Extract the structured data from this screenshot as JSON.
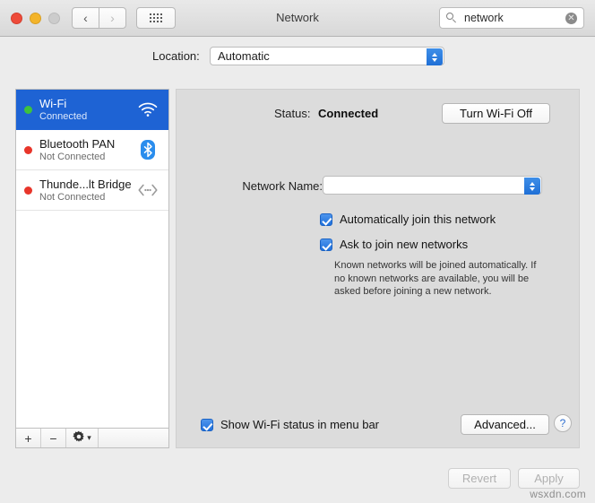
{
  "window": {
    "title": "Network",
    "traffic_lights": {
      "close": "close-button",
      "minimize": "minimize-button",
      "zoom": "zoom-button-disabled"
    },
    "nav": {
      "back": "‹",
      "forward": "›"
    },
    "show_all": "show-all-grid",
    "search": {
      "value": "network",
      "placeholder": "Search",
      "clear": "✕"
    }
  },
  "location": {
    "label": "Location:",
    "value": "Automatic"
  },
  "sidebar": {
    "services": [
      {
        "name": "Wi-Fi",
        "state": "Connected",
        "status_color": "#3ec23e",
        "icon": "wifi-icon",
        "selected": true
      },
      {
        "name": "Bluetooth PAN",
        "state": "Not Connected",
        "status_color": "#e8352a",
        "icon": "bluetooth-icon",
        "selected": false
      },
      {
        "name": "Thunde...lt Bridge",
        "state": "Not Connected",
        "status_color": "#e8352a",
        "icon": "thunderbolt-bridge-icon",
        "selected": false
      }
    ],
    "toolbar": {
      "add": "+",
      "remove": "−",
      "action": "gear-icon",
      "action_chevron": "⌄"
    }
  },
  "main": {
    "status_label": "Status:",
    "status_value": "Connected",
    "toggle_wifi_label": "Turn Wi-Fi Off",
    "network_name_label": "Network Name:",
    "network_name_value": "",
    "auto_join_label": "Automatically join this network",
    "ask_join_label": "Ask to join new networks",
    "join_help_text": "Known networks will be joined automatically. If no known networks are available, you will be asked before joining a new network.",
    "show_menubar_label": "Show Wi-Fi status in menu bar",
    "advanced_label": "Advanced...",
    "help_label": "?"
  },
  "footer": {
    "revert_label": "Revert",
    "apply_label": "Apply",
    "watermark": "wsxdn.com"
  },
  "colors": {
    "selection_blue": "#1e63d4",
    "accent_blue": "#1f70dc",
    "connected_green": "#3ec23e",
    "disconnected_red": "#e8352a"
  }
}
